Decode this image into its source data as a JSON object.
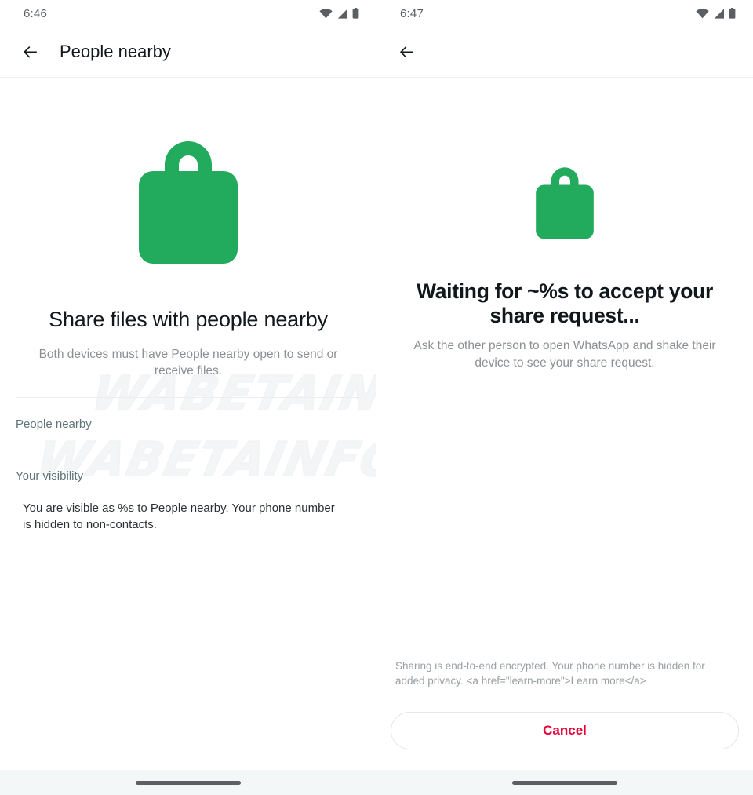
{
  "watermark": {
    "text": "WABETAINFO",
    "color": "#f2f4f5"
  },
  "colors": {
    "lock_green": "#22ab5c",
    "cancel_red": "#ea0038",
    "section_teal": "#5f7478",
    "muted_gray": "#8b9093",
    "title_black": "#11181c",
    "nav_bar_bg": "#f4f7f7"
  },
  "screens": [
    {
      "id": "people-nearby",
      "status_bar": {
        "time": "6:46",
        "icons": [
          "wifi-icon",
          "signal-icon",
          "battery-icon"
        ]
      },
      "app_bar": {
        "back_icon": "arrow-left-icon",
        "title": "People nearby"
      },
      "hero": {
        "icon": "lock-icon",
        "title": "Share files with people nearby",
        "subtitle": "Both devices must have People nearby open to send or receive files."
      },
      "list": {
        "section_label": "People nearby",
        "visibility_label": "Your visibility",
        "visibility_text": "You are visible as %s to People nearby. Your phone number is hidden to non-contacts."
      },
      "nav_bar": {
        "pill": "home-gesture-pill"
      }
    },
    {
      "id": "waiting-for-accept",
      "status_bar": {
        "time": "6:47",
        "icons": [
          "wifi-icon",
          "signal-icon",
          "battery-icon"
        ]
      },
      "app_bar": {
        "back_icon": "arrow-left-icon",
        "title": ""
      },
      "hero": {
        "icon": "lock-icon",
        "title": "Waiting for ~%s to accept your share request...",
        "subtitle": "Ask the other person to open WhatsApp and shake their device to see your share request."
      },
      "footer": {
        "note": "Sharing is end-to-end encrypted. Your phone number is hidden for added privacy. <a href=\"learn-more\">Learn more</a>",
        "cancel_label": "Cancel"
      },
      "nav_bar": {
        "pill": "home-gesture-pill"
      }
    }
  ]
}
